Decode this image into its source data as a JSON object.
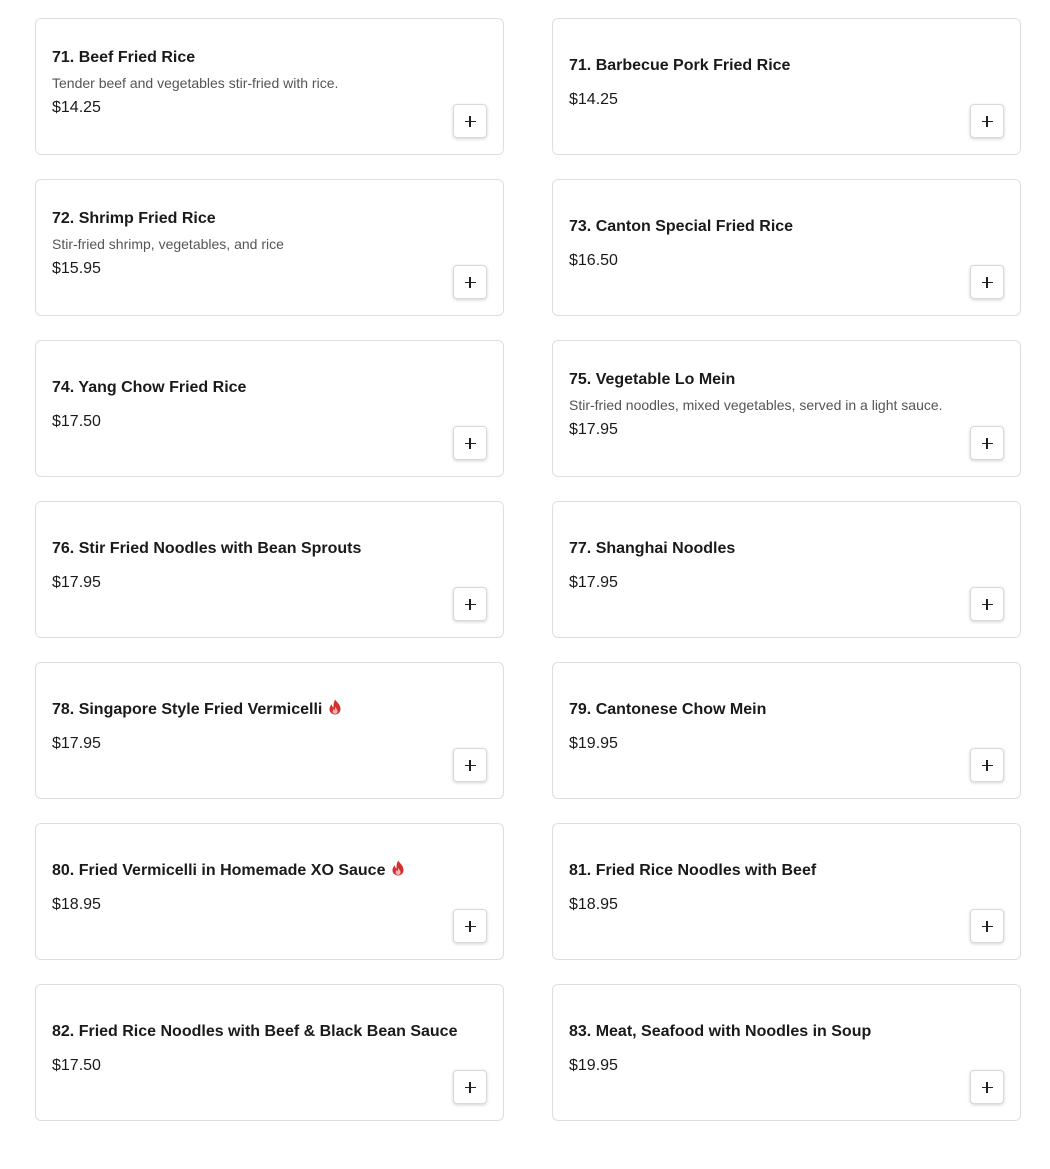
{
  "accent_colors": {
    "spicy": "#d32f2f",
    "card_border": "#dedede",
    "text": "#1a1a1a",
    "muted_text": "#555555"
  },
  "items": [
    {
      "name": "71. Beef Fried Rice",
      "description": "Tender beef and vegetables stir-fried with rice.",
      "price": "$14.25",
      "spicy": false,
      "add_icon": "plus-icon"
    },
    {
      "name": "71. Barbecue Pork Fried Rice",
      "description": "",
      "price": "$14.25",
      "spicy": false,
      "add_icon": "plus-icon"
    },
    {
      "name": "72. Shrimp Fried Rice",
      "description": "Stir-fried shrimp, vegetables, and rice",
      "price": "$15.95",
      "spicy": false,
      "add_icon": "plus-icon"
    },
    {
      "name": "73. Canton Special Fried Rice",
      "description": "",
      "price": "$16.50",
      "spicy": false,
      "add_icon": "plus-icon"
    },
    {
      "name": "74. Yang Chow Fried Rice",
      "description": "",
      "price": "$17.50",
      "spicy": false,
      "add_icon": "plus-icon"
    },
    {
      "name": "75. Vegetable Lo Mein",
      "description": "Stir-fried noodles, mixed vegetables, served in a light sauce.",
      "price": "$17.95",
      "spicy": false,
      "add_icon": "plus-icon"
    },
    {
      "name": "76. Stir Fried Noodles with Bean Sprouts",
      "description": "",
      "price": "$17.95",
      "spicy": false,
      "add_icon": "plus-icon"
    },
    {
      "name": "77. Shanghai Noodles",
      "description": "",
      "price": "$17.95",
      "spicy": false,
      "add_icon": "plus-icon"
    },
    {
      "name": "78. Singapore Style Fried Vermicelli",
      "description": "",
      "price": "$17.95",
      "spicy": true,
      "add_icon": "plus-icon"
    },
    {
      "name": "79. Cantonese Chow Mein",
      "description": "",
      "price": "$19.95",
      "spicy": false,
      "add_icon": "plus-icon"
    },
    {
      "name": "80. Fried Vermicelli in Homemade XO Sauce",
      "description": "",
      "price": "$18.95",
      "spicy": true,
      "add_icon": "plus-icon"
    },
    {
      "name": "81. Fried Rice Noodles with Beef",
      "description": "",
      "price": "$18.95",
      "spicy": false,
      "add_icon": "plus-icon"
    },
    {
      "name": "82. Fried Rice Noodles with Beef & Black Bean Sauce",
      "description": "",
      "price": "$17.50",
      "spicy": false,
      "add_icon": "plus-icon"
    },
    {
      "name": "83. Meat, Seafood with Noodles in Soup",
      "description": "",
      "price": "$19.95",
      "spicy": false,
      "add_icon": "plus-icon"
    }
  ]
}
